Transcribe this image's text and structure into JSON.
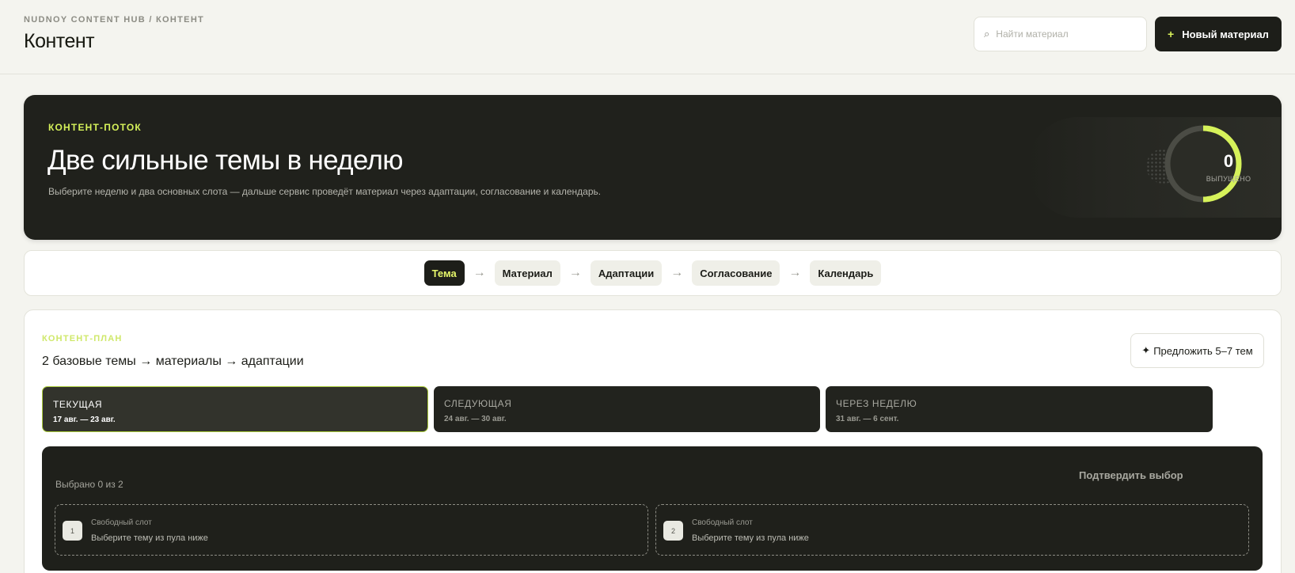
{
  "header": {
    "breadcrumb": "NUDNOY CONTENT HUB / КОНТЕНТ",
    "title": "Контент",
    "search_icon": "⌕",
    "search_placeholder": "Найти материал",
    "new_button_icon": "+",
    "new_button_label": "Новый материал"
  },
  "hero": {
    "tag": "КОНТЕНТ-ПОТОК",
    "title": "Две сильные темы в неделю",
    "subtitle": "Выберите неделю и два основных слота — дальше сервис проведёт материал через адаптации, согласование и календарь.",
    "released_count": "0",
    "released_label": "ВЫПУЩЕНО",
    "accent_color": "#d6f25a"
  },
  "stepper": {
    "arrow": "→",
    "steps": [
      {
        "label": "Тема",
        "active": true
      },
      {
        "label": "Материал",
        "active": false
      },
      {
        "label": "Адаптации",
        "active": false
      },
      {
        "label": "Согласование",
        "active": false
      },
      {
        "label": "Календарь",
        "active": false
      }
    ]
  },
  "plan": {
    "tag": "КОНТЕНТ-ПЛАН",
    "title": "2 базовые темы → материалы → адаптации",
    "suggest_icon": "✦",
    "suggest_label": "Предложить 5–7 тем",
    "weeks": [
      {
        "name": "ТЕКУЩАЯ",
        "dates": "17 авг. — 23 авг.",
        "active": true
      },
      {
        "name": "СЛЕДУЮЩАЯ",
        "dates": "24 авг. — 30 авг.",
        "active": false
      },
      {
        "name": "ЧЕРЕЗ НЕДЕЛЮ",
        "dates": "31 авг. — 6 сент.",
        "active": false
      }
    ],
    "selected_text": "Выбрано 0 из 2",
    "confirm_label": "Подтвердить выбор",
    "slots": [
      {
        "number": "1",
        "label": "Свободный слот",
        "hint": "Выберите тему из пула ниже"
      },
      {
        "number": "2",
        "label": "Свободный слот",
        "hint": "Выберите тему из пула ниже"
      }
    ]
  }
}
